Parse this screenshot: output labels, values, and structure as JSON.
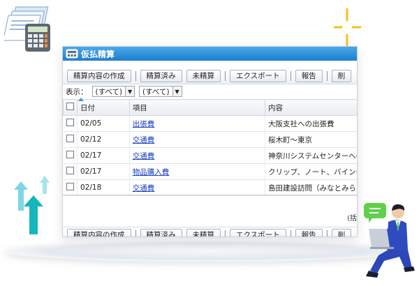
{
  "window": {
    "title": "仮払精算"
  },
  "toolbar": {
    "buttons": [
      "精算内容の作成",
      "精算済み",
      "未精算",
      "エクスポート",
      "報告",
      "削"
    ]
  },
  "bottom_toolbar": {
    "buttons": [
      "精算内容の作成",
      "精算済み",
      "未精算",
      "エクスポート",
      "報告",
      "削"
    ]
  },
  "filters": {
    "label": "表示：",
    "select1": "(すべて)",
    "select2": "(すべて)"
  },
  "table": {
    "columns": [
      "日付",
      "項目",
      "内容"
    ],
    "rows": [
      {
        "date": "02/05",
        "item": "出張費",
        "content": "大阪支社への出張費"
      },
      {
        "date": "02/12",
        "item": "交通費",
        "content": "桜木町～東京"
      },
      {
        "date": "02/17",
        "item": "交通費",
        "content": "神奈川システムセンターへの"
      },
      {
        "date": "02/17",
        "item": "物品購入費",
        "content": "クリップ、ノート、バインダ"
      },
      {
        "date": "02/18",
        "item": "交通費",
        "content": "島田建設訪問（みなとみらい"
      }
    ]
  },
  "footer_note": "(括"
}
